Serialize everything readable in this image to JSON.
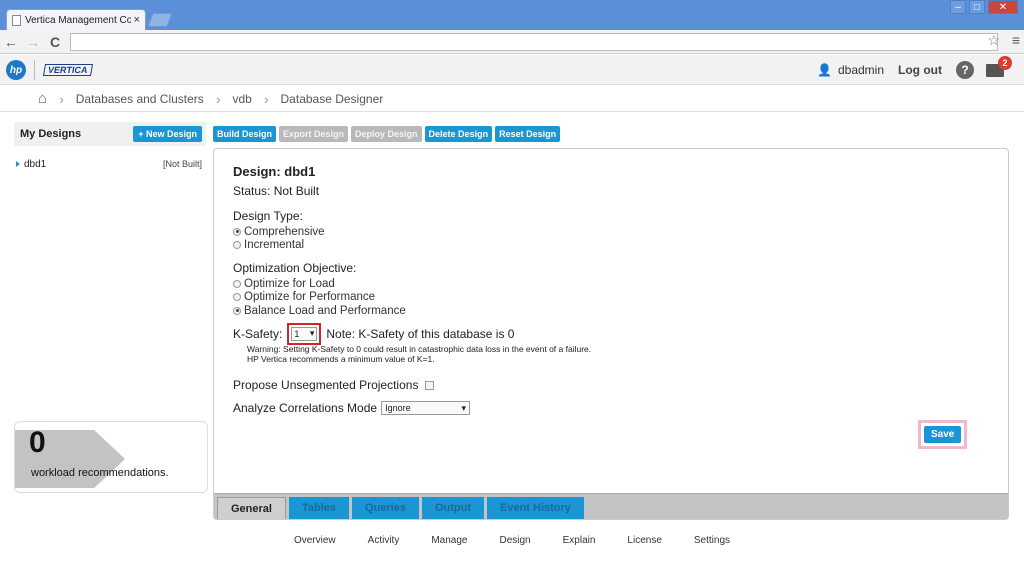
{
  "browser": {
    "tab_title": "Vertica Management Co",
    "tab_close": "×",
    "back": "←",
    "forward": "→",
    "reload": "C",
    "star": "☆",
    "menu": "≡",
    "window_controls": [
      "–",
      "□",
      "✕"
    ]
  },
  "header": {
    "hp_logo": "hp",
    "vertica_logo": "VERTICA",
    "user": "dbadmin",
    "logout": "Log out",
    "help": "?",
    "mail_count": "2"
  },
  "breadcrumb": {
    "home_icon": "⌂",
    "items": [
      "Databases and Clusters",
      "vdb",
      "Database Designer"
    ]
  },
  "left": {
    "title": "My Designs",
    "new_design": "+ New Design",
    "designs": [
      {
        "name": "dbd1",
        "status": "[Not Built]"
      }
    ],
    "workload_count": "0",
    "workload_label": "workload recommendations."
  },
  "actions": {
    "build": "Build Design",
    "export": "Export Design",
    "deploy": "Deploy Design",
    "delete": "Delete Design",
    "reset": "Reset Design"
  },
  "design": {
    "title": "Design: dbd1",
    "status": "Status: Not Built",
    "design_type_label": "Design Type:",
    "design_types": [
      {
        "label": "Comprehensive",
        "checked": true
      },
      {
        "label": "Incremental",
        "checked": false
      }
    ],
    "objective_label": "Optimization Objective:",
    "objectives": [
      {
        "label": "Optimize for Load",
        "checked": false
      },
      {
        "label": "Optimize for Performance",
        "checked": false
      },
      {
        "label": "Balance Load and Performance",
        "checked": true
      }
    ],
    "ksafety_label": "K-Safety:",
    "ksafety_value": "1",
    "ksafety_note": "Note: K-Safety of this database is 0",
    "warning_line1": "Warning: Setting K-Safety to 0 could result in catastrophic data loss in the event of a failure.",
    "warning_line2": "HP Vertica recommends a minimum value of K=1.",
    "propose_label": "Propose Unsegmented Projections",
    "correlations_label": "Analyze Correlations Mode",
    "correlations_value": "Ignore",
    "save": "Save",
    "tabs": [
      "General",
      "Tables",
      "Queries",
      "Output",
      "Event History"
    ],
    "active_tab": "General"
  },
  "footer": {
    "links": [
      "Overview",
      "Activity",
      "Manage",
      "Design",
      "Explain",
      "License",
      "Settings"
    ]
  },
  "colors": {
    "accent": "#1a96d4",
    "highlight_red": "#d0242a",
    "highlight_pink": "#f0b8cc"
  }
}
